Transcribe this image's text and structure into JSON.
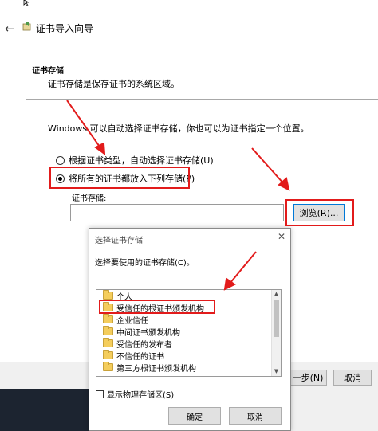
{
  "wizard": {
    "title": "证书导入向导",
    "section_heading": "证书存储",
    "section_description": "证书存储是保存证书的系统区域。",
    "intro": "Windows 可以自动选择证书存储，你也可以为证书指定一个位置。",
    "radio_auto_label": "根据证书类型，自动选择证书存储(U)",
    "radio_manual_label": "将所有的证书都放入下列存储(P)",
    "radio_selected": "manual",
    "store_label": "证书存储:",
    "store_value": "",
    "browse_label": "浏览(R)...",
    "next_label": "一步(N)",
    "cancel_label": "取消"
  },
  "dialog": {
    "title": "选择证书存储",
    "close_glyph": "✕",
    "prompt": "选择要使用的证书存储(C)。",
    "items": [
      {
        "label": "个人"
      },
      {
        "label": "受信任的根证书颁发机构"
      },
      {
        "label": "企业信任"
      },
      {
        "label": "中间证书颁发机构"
      },
      {
        "label": "受信任的发布者"
      },
      {
        "label": "不信任的证书"
      },
      {
        "label": "第三方根证书颁发机构"
      }
    ],
    "highlighted_item": "受信任的根证书颁发机构",
    "show_physical_label": "显示物理存储区(S)",
    "show_physical_checked": false,
    "ok_label": "确定",
    "cancel_label": "取消"
  },
  "annotation_color": "#e21b1b",
  "icons": {
    "back": "back-arrow-icon",
    "wizard": "certificate-icon",
    "folder": "folder-icon"
  }
}
